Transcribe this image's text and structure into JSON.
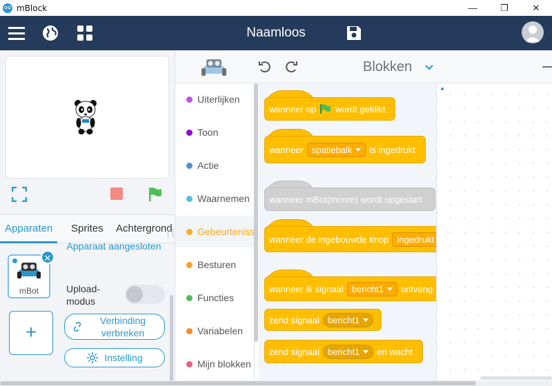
{
  "window": {
    "app_name": "mBlock",
    "minimize": "—",
    "maximize": "❐",
    "close": "✕"
  },
  "topbar": {
    "doc_title": "Naamloos",
    "menu_icon": "menu-icon",
    "globe_icon": "globe-icon",
    "apps_icon": "apps-icon",
    "save_icon": "save-icon",
    "avatar_icon": "user-avatar-icon"
  },
  "stage_controls": {
    "fullscreen_icon": "fullscreen-icon",
    "stop_icon": "stop-icon",
    "go_icon": "green-flag-icon"
  },
  "tabs": [
    {
      "label": "Apparaten",
      "active": true
    },
    {
      "label": "Sprites",
      "active": false
    },
    {
      "label": "Achtergrond",
      "active": false
    }
  ],
  "device": {
    "name": "mBot",
    "close": "✕"
  },
  "add_device": "+",
  "connection": {
    "status": "Apparaat aangesloten",
    "upload_mode_label": "Upload-modus",
    "upload_mode_on": false,
    "disconnect_button": "Verbinding verbreken",
    "settings_button": "Instelling"
  },
  "blocks_header": {
    "title": "Blokken"
  },
  "categories": [
    {
      "label": "Uiterlijken",
      "color": "#c651e8",
      "active": false
    },
    {
      "label": "Toon",
      "color": "#9400d8",
      "active": false
    },
    {
      "label": "Actie",
      "color": "#4a90d9",
      "active": false
    },
    {
      "label": "Waarnemen",
      "color": "#4fc1e0",
      "active": false
    },
    {
      "label": "Gebeurtenissen",
      "color": "#ffab19",
      "active": true
    },
    {
      "label": "Besturen",
      "color": "#ffa21c",
      "active": false
    },
    {
      "label": "Functies",
      "color": "#4cbf56",
      "active": false
    },
    {
      "label": "Variabelen",
      "color": "#ff8c1a",
      "active": false
    },
    {
      "label": "Mijn blokken",
      "color": "#ea5f7c",
      "active": false
    }
  ],
  "blocks": {
    "b1": {
      "before": "wanneer op",
      "after": "wordt geklikt"
    },
    "b2": {
      "before": "wanneer",
      "drop": "spatiebalk",
      "after": "is ingedrukt"
    },
    "b3": {
      "text": "wanneer mBot(mcore) wordt opgestart"
    },
    "b4": {
      "before": "wanneer de ingebouwde knop",
      "drop": "ingedrukt"
    },
    "b5": {
      "before": "wanneer ik signaal",
      "drop": "bericht1",
      "after": "ontvang"
    },
    "b6": {
      "before": "zend signaal",
      "drop": "bericht1"
    },
    "b7": {
      "before": "zend signaal",
      "drop": "bericht1",
      "after": "en wacht"
    }
  },
  "colors": {
    "topbar": "#253b5b",
    "accent": "#2b97ce",
    "event_block": "#ffbf00"
  }
}
